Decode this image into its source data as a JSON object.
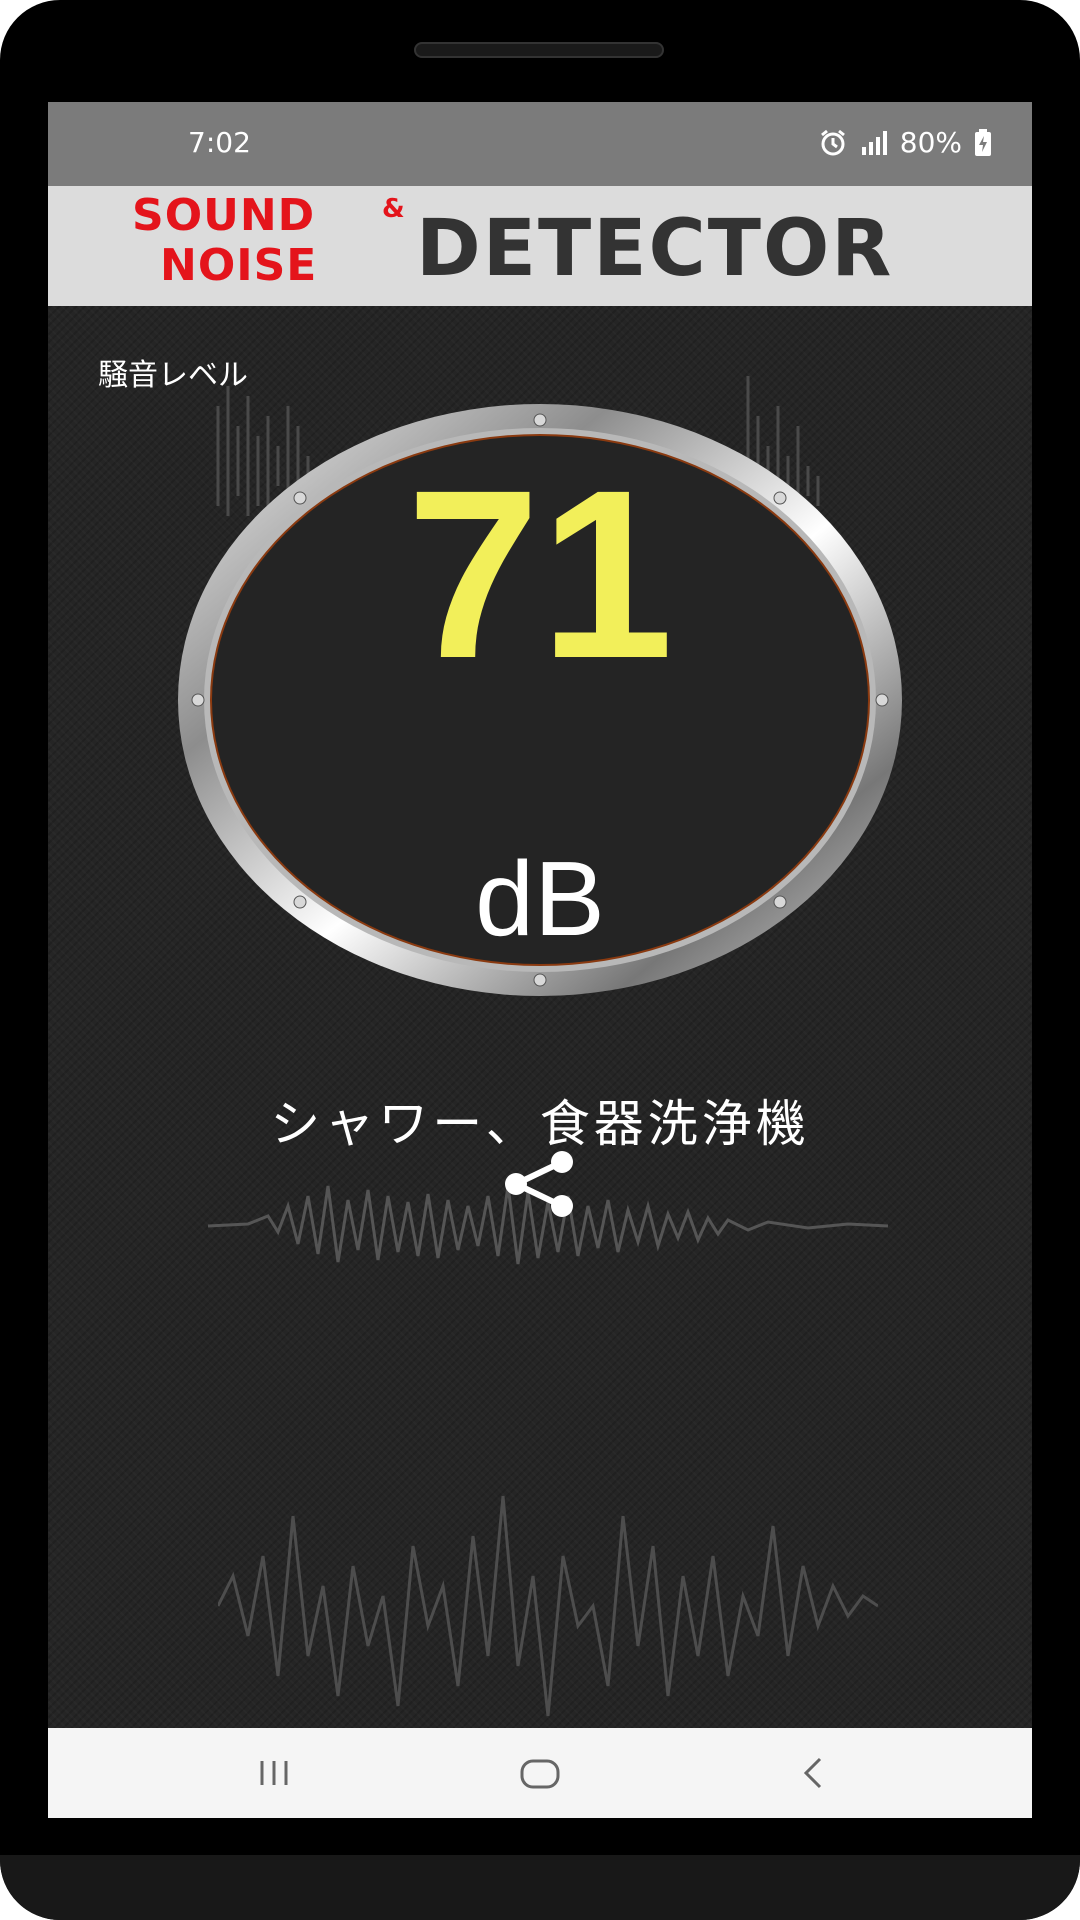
{
  "status_bar": {
    "time": "7:02",
    "battery": "80%",
    "icons": [
      "alarm-icon",
      "signal-icon",
      "battery-charging-icon"
    ]
  },
  "header": {
    "logo_sound": "SOUND",
    "logo_amp": "&",
    "logo_noise": "NOISE",
    "logo_detector": "DETECTOR"
  },
  "meter": {
    "label": "騒音レベル",
    "value": "71",
    "unit": "dB",
    "description": "シャワー、食器洗浄機"
  },
  "actions": {
    "share_icon": "share-icon"
  },
  "nav": {
    "icons": [
      "recent-apps-icon",
      "home-icon",
      "back-icon"
    ]
  },
  "colors": {
    "value": "#f2ef5a",
    "logo_red": "#e4141b",
    "logo_dark": "#333333",
    "background": "#252525"
  }
}
